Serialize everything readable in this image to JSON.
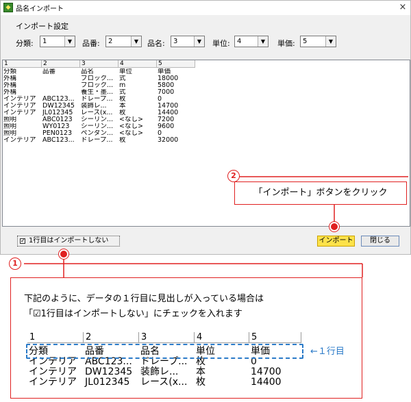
{
  "window": {
    "title": "品名インポート",
    "close_symbol": "×",
    "settings_title": "インポート設定"
  },
  "fields": [
    {
      "label": "分類:",
      "value": "1"
    },
    {
      "label": "品番:",
      "value": "2"
    },
    {
      "label": "品名:",
      "value": "3"
    },
    {
      "label": "単位:",
      "value": "4"
    },
    {
      "label": "単価:",
      "value": "5"
    }
  ],
  "grid": {
    "columns": [
      "1",
      "2",
      "3",
      "4",
      "5"
    ],
    "rows": [
      [
        "分類",
        "品番",
        "品名",
        "単位",
        "単価"
      ],
      [
        "外構",
        "",
        "ブロック...",
        "式",
        "18000"
      ],
      [
        "外構",
        "",
        "ブロック...",
        "m",
        "5800"
      ],
      [
        "外構",
        "",
        "養生・墨...",
        "式",
        "7000"
      ],
      [
        "インテリア",
        "ABC123...",
        "ドレープ...",
        "枚",
        "0"
      ],
      [
        "インテリア",
        "DW12345",
        "装飾レ...",
        "本",
        "14700"
      ],
      [
        "インテリア",
        "JL012345",
        "レース(x...",
        "枚",
        "14400"
      ],
      [
        "照明",
        "ABC0123",
        "シーリン...",
        "<なし>",
        "7200"
      ],
      [
        "照明",
        "WY0123",
        "シーリン...",
        "<なし>",
        "9600"
      ],
      [
        "照明",
        "PEN0123",
        "ペンダン...",
        "<なし>",
        "0"
      ],
      [
        "インテリア",
        "ABC123...",
        "ドレープ...",
        "枚",
        "32000"
      ]
    ]
  },
  "bottom": {
    "checkbox_label": "1行目はインポートしない",
    "checkbox_checked": true,
    "import_label": "インポート",
    "close_label": "閉じる"
  },
  "annotations": {
    "callout2_num": "2",
    "callout2_text": "「インポート」ボタンをクリック",
    "callout1_num": "1",
    "callout1_line1": "下記のように、データの１行目に見出しが入っている場合は",
    "callout1_line2": "「☑1行目はインポートしない」にチェックを入れます",
    "row1_label": "←１行目",
    "accent_red": "#e02020",
    "accent_blue": "#2a7ac8"
  },
  "example": {
    "columns": [
      "1",
      "2",
      "3",
      "4",
      "5"
    ],
    "rows": [
      [
        "分類",
        "品番",
        "品名",
        "単位",
        "単価"
      ],
      [
        "インテリア",
        "ABC123...",
        "ドレープ...",
        "枚",
        "0"
      ],
      [
        "インテリア",
        "DW12345",
        "装飾レ...",
        "本",
        "14700"
      ],
      [
        "インテリア",
        "JL012345",
        "レース(x...",
        "枚",
        "14400"
      ]
    ]
  }
}
